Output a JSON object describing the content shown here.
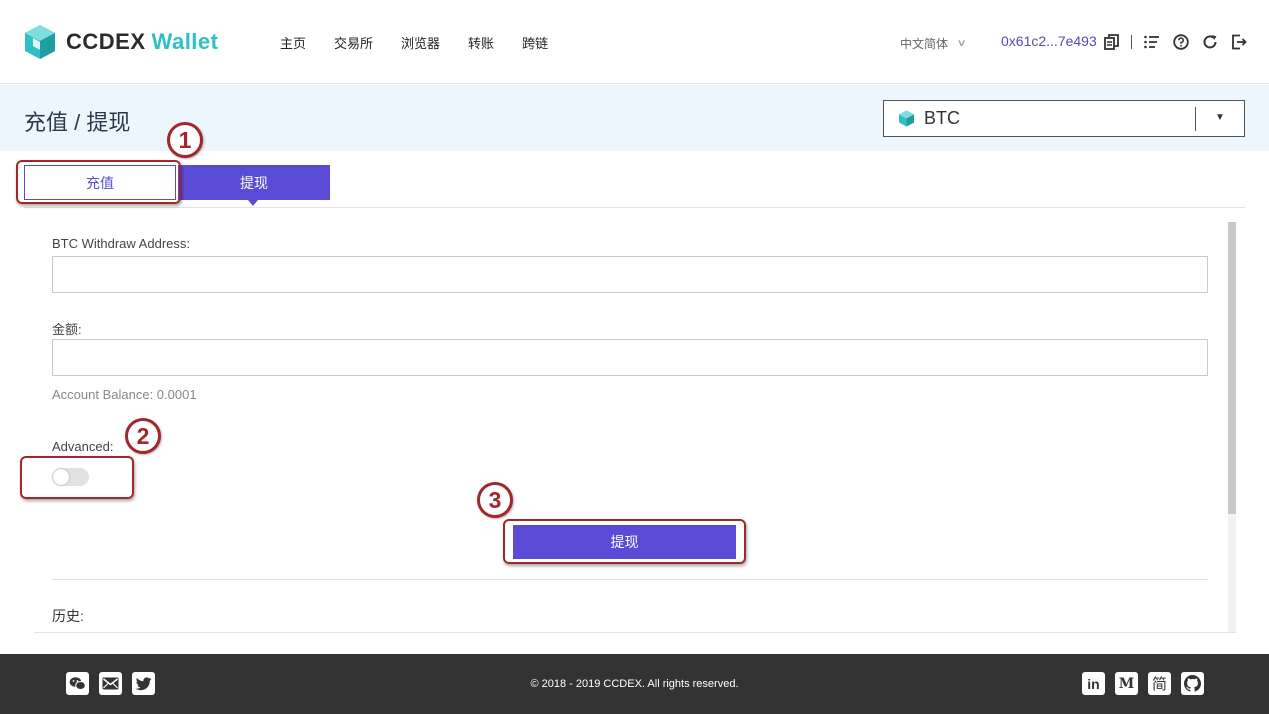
{
  "header": {
    "logo_primary": "CCDEX",
    "logo_secondary": "Wallet",
    "nav": [
      "主页",
      "交易所",
      "浏览器",
      "转账",
      "跨链"
    ],
    "language": "中文简体",
    "address": "0x61c2...7e493"
  },
  "titlebar": {
    "title": "充值 / 提现",
    "coin": "BTC"
  },
  "tabs": {
    "deposit": "充值",
    "withdraw": "提现"
  },
  "form": {
    "address_label": "BTC Withdraw Address:",
    "address_value": "",
    "amount_label": "金额:",
    "amount_value": "",
    "balance": "Account Balance: 0.0001",
    "advanced_label": "Advanced:",
    "advanced_on": false,
    "submit": "提现",
    "history_label": "历史:"
  },
  "annotations": [
    "1",
    "2",
    "3"
  ],
  "footer": {
    "copyright": "© 2018 - 2019 CCDEX. All rights reserved.",
    "social_right": [
      "in",
      "M",
      "简"
    ]
  },
  "colors": {
    "accent": "#5a4bd6",
    "logo_teal": "#2fc0c4",
    "annotation": "#a3262a",
    "footer_bg": "#333333",
    "title_band": "#eef6fd"
  }
}
